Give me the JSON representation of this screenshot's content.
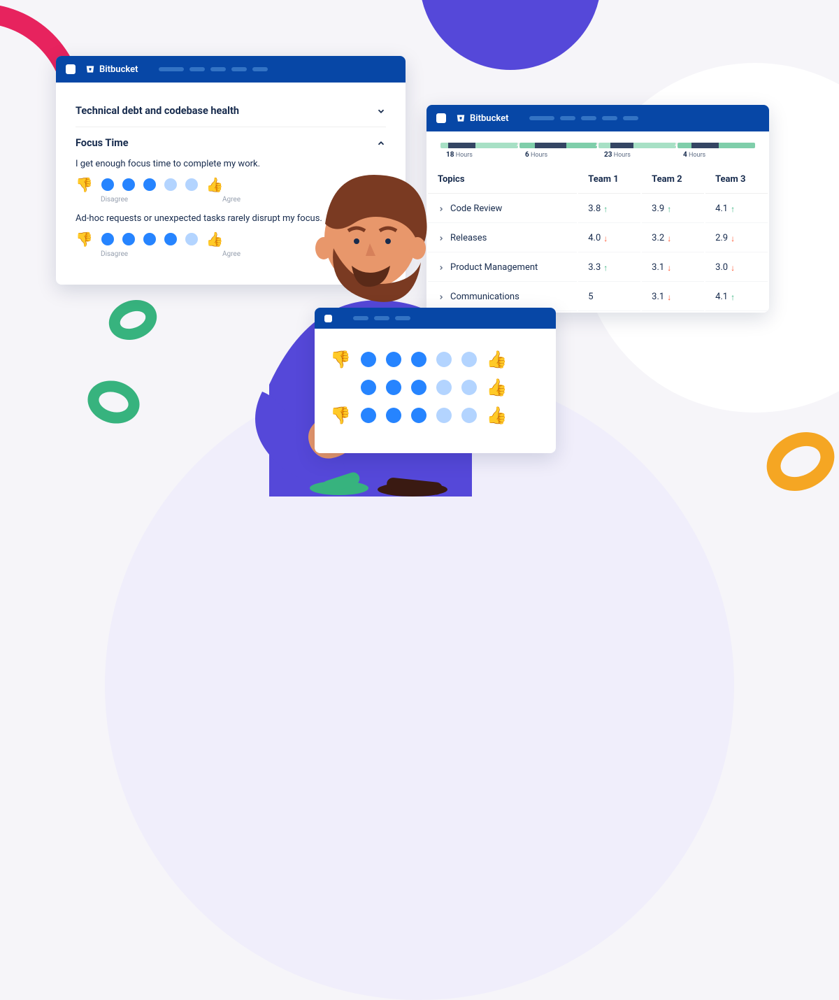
{
  "app": {
    "name": "Bitbucket"
  },
  "survey": {
    "section_collapsed": "Technical debt and codebase health",
    "section_expanded": "Focus Time",
    "q1": "I get enough focus time to complete my work.",
    "q2": "Ad-hoc requests or unexpected tasks rarely disrupt my focus.",
    "label_disagree": "Disagree",
    "label_agree": "Agree"
  },
  "metrics": {
    "timeline": [
      {
        "value": "18",
        "unit": "Hours"
      },
      {
        "value": "6",
        "unit": "Hours"
      },
      {
        "value": "23",
        "unit": "Hours"
      },
      {
        "value": "4",
        "unit": "Hours"
      }
    ],
    "columns": {
      "c0": "Topics",
      "c1": "Team 1",
      "c2": "Team 2",
      "c3": "Team 3"
    },
    "rows": [
      {
        "topic": "Code Review",
        "t1": "3.8",
        "t1d": "up",
        "t2": "3.9",
        "t2d": "up",
        "t3": "4.1",
        "t3d": "up"
      },
      {
        "topic": "Releases",
        "t1": "4.0",
        "t1d": "down",
        "t2": "3.2",
        "t2d": "down",
        "t3": "2.9",
        "t3d": "down"
      },
      {
        "topic": "Product Management",
        "t1": "3.3",
        "t1d": "up",
        "t2": "3.1",
        "t2d": "down",
        "t3": "3.0",
        "t3d": "down"
      },
      {
        "topic": "Communications",
        "t1": "5",
        "t1d": "",
        "t2": "3.1",
        "t2d": "down",
        "t3": "4.1",
        "t3d": "up"
      }
    ]
  }
}
